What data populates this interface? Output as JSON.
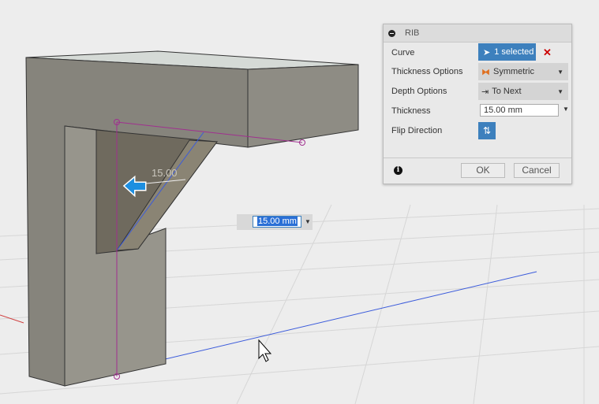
{
  "dialog": {
    "title": "RIB",
    "rows": [
      {
        "label": "Curve",
        "value": "1 selected"
      },
      {
        "label": "Thickness Options",
        "value": "Symmetric"
      },
      {
        "label": "Depth Options",
        "value": "To Next"
      },
      {
        "label": "Thickness",
        "value": "15.00 mm"
      },
      {
        "label": "Flip Direction"
      }
    ],
    "ok": "OK",
    "cancel": "Cancel"
  },
  "viewport": {
    "dimension_label": "15.00",
    "dimension_input": "15.00 mm"
  },
  "colors": {
    "accent": "#3d80bd",
    "clear": "#cc0000",
    "sketch": "#a0308f",
    "axis_blue": "#3b5bdb"
  }
}
